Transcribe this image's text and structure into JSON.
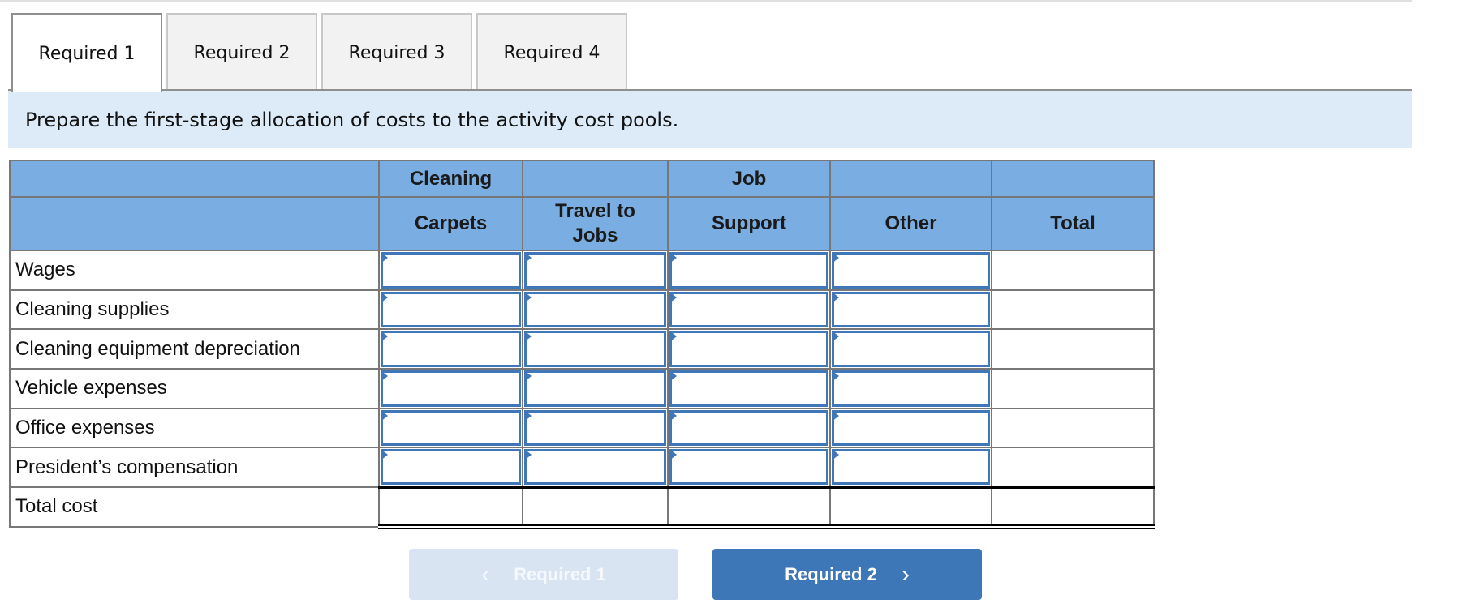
{
  "tabs": [
    {
      "label": "Required 1",
      "active": true
    },
    {
      "label": "Required 2",
      "active": false
    },
    {
      "label": "Required 3",
      "active": false
    },
    {
      "label": "Required 4",
      "active": false
    }
  ],
  "instruction": "Prepare the first-stage allocation of costs to the activity cost pools.",
  "table": {
    "header_row1": [
      "",
      "Cleaning",
      "",
      "Job",
      "",
      ""
    ],
    "header_row2": [
      "",
      "Carpets",
      "Travel to Jobs",
      "Support",
      "Other",
      "Total"
    ],
    "rows": [
      {
        "label": "Wages",
        "values": [
          "",
          "",
          "",
          "",
          ""
        ]
      },
      {
        "label": "Cleaning supplies",
        "values": [
          "",
          "",
          "",
          "",
          ""
        ]
      },
      {
        "label": "Cleaning equipment depreciation",
        "values": [
          "",
          "",
          "",
          "",
          ""
        ]
      },
      {
        "label": "Vehicle expenses",
        "values": [
          "",
          "",
          "",
          "",
          ""
        ]
      },
      {
        "label": "Office expenses",
        "values": [
          "",
          "",
          "",
          "",
          ""
        ]
      },
      {
        "label": "President’s compensation",
        "values": [
          "",
          "",
          "",
          "",
          ""
        ]
      }
    ],
    "total_row": {
      "label": "Total cost",
      "values": [
        "",
        "",
        "",
        "",
        ""
      ]
    }
  },
  "nav": {
    "prev_label": "Required 1",
    "prev_icon": "chevron-left-icon",
    "next_label": "Required 2",
    "next_icon": "chevron-right-icon",
    "prev_glyph": "‹",
    "next_glyph": "›"
  },
  "colors": {
    "header_bg": "#7aade1",
    "input_border": "#3f77b8",
    "instruction_bg": "#dcebf7",
    "next_button": "#3d77b8",
    "prev_button_disabled": "#d8e4f2"
  }
}
